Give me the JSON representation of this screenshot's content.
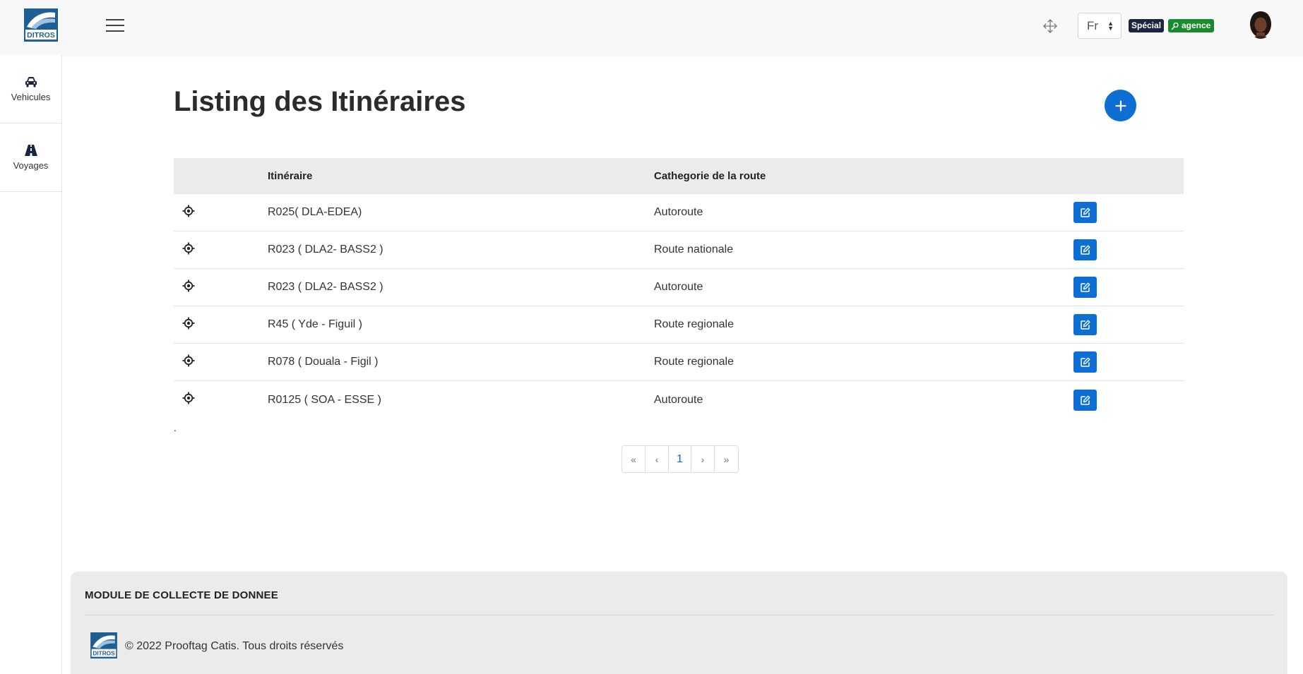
{
  "header": {
    "logo_text": "DITROS",
    "language": "Fr",
    "badge_special": "Spécial",
    "badge_agence": "agence",
    "icons": {
      "menu": "hamburger-icon",
      "fullscreen": "move-arrows-icon",
      "user": "user-search-icon"
    }
  },
  "sidebar": {
    "items": [
      {
        "label": "Vehicules",
        "icon": "car-icon"
      },
      {
        "label": "Voyages",
        "icon": "road-icon"
      }
    ]
  },
  "main": {
    "title": "Listing des Itinéraires",
    "add_button": "+",
    "table": {
      "headers": [
        "",
        "Itinéraire",
        "Cathegorie de la route",
        ""
      ],
      "rows": [
        {
          "itineraire": "R025( DLA-EDEA)",
          "categorie": "Autoroute"
        },
        {
          "itineraire": "R023 ( DLA2- BASS2 )",
          "categorie": "Route nationale"
        },
        {
          "itineraire": "R023 ( DLA2- BASS2 )",
          "categorie": "Autoroute"
        },
        {
          "itineraire": "R45 ( Yde - Figuil )",
          "categorie": "Route regionale"
        },
        {
          "itineraire": "R078 ( Douala - Figil )",
          "categorie": "Route regionale"
        },
        {
          "itineraire": "R0125 ( SOA - ESSE )",
          "categorie": "Autoroute"
        }
      ]
    },
    "dot": ".",
    "pagination": {
      "first": "«",
      "prev": "‹",
      "current": "1",
      "next": "›",
      "last": "»"
    }
  },
  "footer": {
    "title": "MODULE DE COLLECTE DE DONNEE",
    "copyright": "© 2022 Prooftag Catis. Tous droits réservés"
  },
  "colors": {
    "primary": "#0d6ed4",
    "badge_special": "#1c2540",
    "badge_agence": "#198b2c",
    "header_bg": "#f8f8f8",
    "table_head_bg": "#ebebeb",
    "footer_bg": "#ebebeb",
    "logo_blue": "#1f5e93"
  }
}
